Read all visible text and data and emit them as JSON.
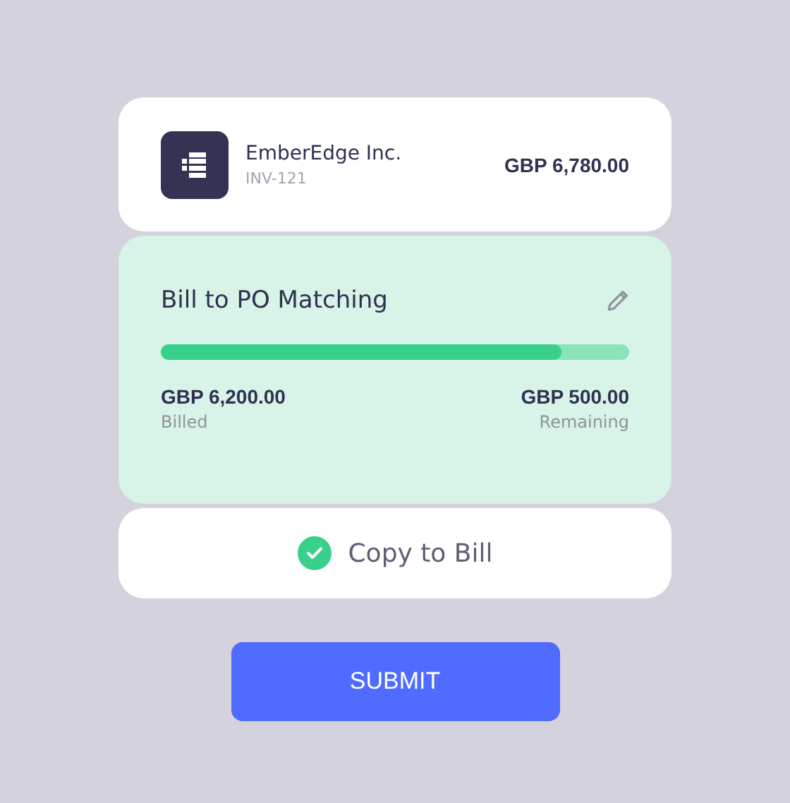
{
  "vendor": {
    "name": "EmberEdge Inc.",
    "invoice": "INV-121",
    "amount": "GBP 6,780.00"
  },
  "matching": {
    "title": "Bill to PO Matching",
    "level": 0.855,
    "billed_amount": "GBP 6,200.00",
    "billed_label": "Billed",
    "remaining_amount": "GBP 500.00",
    "remaining_label": "Remaining"
  },
  "copy_to_bill": {
    "label": "Copy to Bill",
    "checked": true
  },
  "submit": {
    "label": "SUBMIT"
  }
}
